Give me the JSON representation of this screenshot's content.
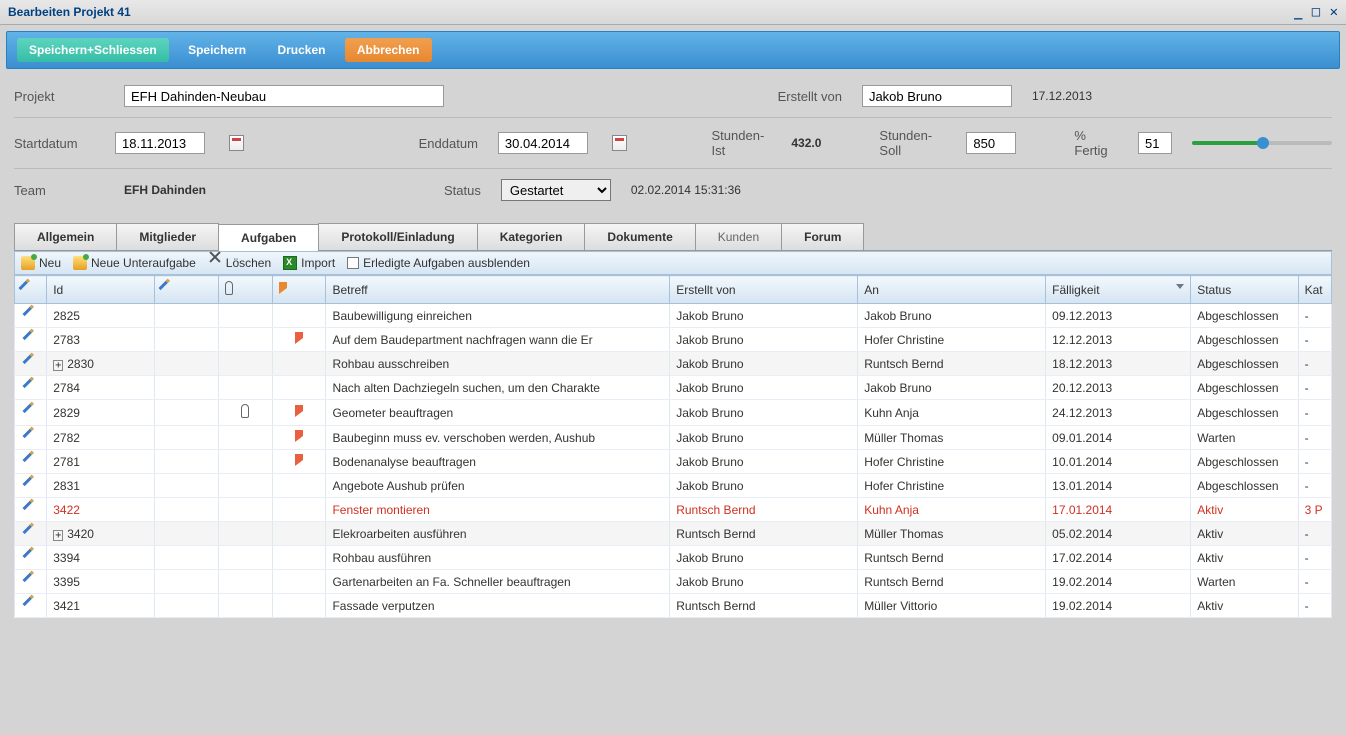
{
  "window": {
    "title": "Bearbeiten Projekt 41"
  },
  "toolbar": {
    "save_close": "Speichern+Schliessen",
    "save": "Speichern",
    "print": "Drucken",
    "cancel": "Abbrechen"
  },
  "form": {
    "project_label": "Projekt",
    "project_value": "EFH Dahinden-Neubau",
    "created_by_label": "Erstellt von",
    "created_by_value": "Jakob Bruno",
    "created_date": "17.12.2013",
    "start_label": "Startdatum",
    "start_value": "18.11.2013",
    "end_label": "Enddatum",
    "end_value": "30.04.2014",
    "hours_actual_label": "Stunden-Ist",
    "hours_actual": "432.0",
    "hours_target_label": "Stunden-Soll",
    "hours_target": "850",
    "percent_label": "% Fertig",
    "percent_value": "51",
    "team_label": "Team",
    "team_value": "EFH Dahinden",
    "status_label": "Status",
    "status_value": "Gestartet",
    "status_timestamp": "02.02.2014 15:31:36"
  },
  "tabs": {
    "t0": "Allgemein",
    "t1": "Mitglieder",
    "t2": "Aufgaben",
    "t3": "Protokoll/Einladung",
    "t4": "Kategorien",
    "t5": "Dokumente",
    "t6": "Kunden",
    "t7": "Forum"
  },
  "subtoolbar": {
    "neu": "Neu",
    "neue_unter": "Neue Unteraufgabe",
    "loeschen": "Löschen",
    "import": "Import",
    "hide_done": "Erledigte Aufgaben ausblenden"
  },
  "columns": {
    "id": "Id",
    "betreff": "Betreff",
    "von": "Erstellt von",
    "an": "An",
    "due": "Fälligkeit",
    "status": "Status",
    "kat": "Kat"
  },
  "rows": [
    {
      "id": "2825",
      "expand": false,
      "clip": false,
      "flag": false,
      "betreff": "Baubewilligung einreichen",
      "von": "Jakob Bruno",
      "an": "Jakob Bruno",
      "due": "09.12.2013",
      "status": "Abgeschlossen",
      "kat": "-",
      "red": false
    },
    {
      "id": "2783",
      "expand": false,
      "clip": false,
      "flag": true,
      "betreff": "Auf dem Baudepartment nachfragen wann die Er",
      "von": "Jakob Bruno",
      "an": "Hofer Christine",
      "due": "12.12.2013",
      "status": "Abgeschlossen",
      "kat": "-",
      "red": false
    },
    {
      "id": "2830",
      "expand": true,
      "clip": false,
      "flag": false,
      "betreff": "Rohbau ausschreiben",
      "von": "Jakob Bruno",
      "an": "Runtsch Bernd",
      "due": "18.12.2013",
      "status": "Abgeschlossen",
      "kat": "-",
      "red": false
    },
    {
      "id": "2784",
      "expand": false,
      "clip": false,
      "flag": false,
      "betreff": "Nach alten Dachziegeln suchen, um den Charakte",
      "von": "Jakob Bruno",
      "an": "Jakob Bruno",
      "due": "20.12.2013",
      "status": "Abgeschlossen",
      "kat": "-",
      "red": false
    },
    {
      "id": "2829",
      "expand": false,
      "clip": true,
      "flag": true,
      "betreff": "Geometer beauftragen",
      "von": "Jakob Bruno",
      "an": "Kuhn Anja",
      "due": "24.12.2013",
      "status": "Abgeschlossen",
      "kat": "-",
      "red": false
    },
    {
      "id": "2782",
      "expand": false,
      "clip": false,
      "flag": true,
      "betreff": "Baubeginn muss ev. verschoben werden, Aushub",
      "von": "Jakob Bruno",
      "an": "Müller Thomas",
      "due": "09.01.2014",
      "status": "Warten",
      "kat": "-",
      "red": false
    },
    {
      "id": "2781",
      "expand": false,
      "clip": false,
      "flag": true,
      "betreff": "Bodenanalyse beauftragen",
      "von": "Jakob Bruno",
      "an": "Hofer Christine",
      "due": "10.01.2014",
      "status": "Abgeschlossen",
      "kat": "-",
      "red": false
    },
    {
      "id": "2831",
      "expand": false,
      "clip": false,
      "flag": false,
      "betreff": "Angebote Aushub prüfen",
      "von": "Jakob Bruno",
      "an": "Hofer Christine",
      "due": "13.01.2014",
      "status": "Abgeschlossen",
      "kat": "-",
      "red": false
    },
    {
      "id": "3422",
      "expand": false,
      "clip": false,
      "flag": false,
      "betreff": "Fenster montieren",
      "von": "Runtsch Bernd",
      "an": "Kuhn Anja",
      "due": "17.01.2014",
      "status": "Aktiv",
      "kat": "3 P",
      "red": true
    },
    {
      "id": "3420",
      "expand": true,
      "clip": false,
      "flag": false,
      "betreff": "Elekroarbeiten ausführen",
      "von": "Runtsch Bernd",
      "an": "Müller Thomas",
      "due": "05.02.2014",
      "status": "Aktiv",
      "kat": "-",
      "red": false
    },
    {
      "id": "3394",
      "expand": false,
      "clip": false,
      "flag": false,
      "betreff": "Rohbau ausführen",
      "von": "Jakob Bruno",
      "an": "Runtsch Bernd",
      "due": "17.02.2014",
      "status": "Aktiv",
      "kat": "-",
      "red": false
    },
    {
      "id": "3395",
      "expand": false,
      "clip": false,
      "flag": false,
      "betreff": "Gartenarbeiten an Fa. Schneller beauftragen",
      "von": "Jakob Bruno",
      "an": "Runtsch Bernd",
      "due": "19.02.2014",
      "status": "Warten",
      "kat": "-",
      "red": false
    },
    {
      "id": "3421",
      "expand": false,
      "clip": false,
      "flag": false,
      "betreff": "Fassade verputzen",
      "von": "Runtsch Bernd",
      "an": "Müller Vittorio",
      "due": "19.02.2014",
      "status": "Aktiv",
      "kat": "-",
      "red": false
    }
  ]
}
